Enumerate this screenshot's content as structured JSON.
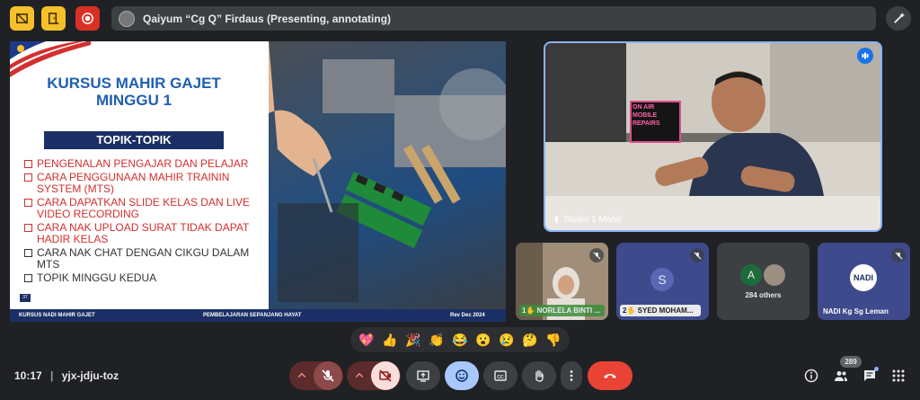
{
  "topbar": {
    "presenter_text": "Qaiyum “Cg Q” Firdaus (Presenting, annotating)"
  },
  "slide": {
    "title_line1": "KURSUS MAHIR GAJET",
    "title_line2": "MINGGU 1",
    "topik_header": "TOPIK-TOPIK",
    "items": [
      {
        "text": "PENGENALAN PENGAJAR DAN PELAJAR",
        "color": "#d32f2f"
      },
      {
        "text": "CARA PENGGUNAAN MAHIR TRAININ SYSTEM (MTS)",
        "color": "#d32f2f"
      },
      {
        "text": "CARA DAPATKAN SLIDE KELAS DAN LIVE VIDEO RECORDING",
        "color": "#d32f2f"
      },
      {
        "text": "CARA NAK UPLOAD SURAT TIDAK DAPAT HADIR KELAS",
        "color": "#d32f2f"
      },
      {
        "text": "CARA NAK CHAT DENGAN CIKGU DALAM MTS",
        "color": "#333333"
      },
      {
        "text": "TOPIK MINGGU KEDUA",
        "color": "#333333"
      }
    ],
    "page_number": "37",
    "footer_left": "KURSUS NADI MAHIR GAJET",
    "footer_center": "PEMBELAJARAN SEPANJANG HAYAT",
    "footer_right": "Rev Dec 2024"
  },
  "main_tile": {
    "name": "Studio 1 Mahir",
    "neon_text_1": "ON AIR",
    "neon_text_2": "MOBILE",
    "neon_text_3": "REPAIRS"
  },
  "tiles": [
    {
      "label": "NORLELA BINTI ...",
      "number": "1"
    },
    {
      "label": "SYED MOHAM...",
      "number": "2",
      "initial": "S"
    },
    {
      "label": "284 others",
      "initial": "A"
    },
    {
      "label": "NADI Kg Sg Leman",
      "logo": "NADI"
    }
  ],
  "reactions": [
    "💖",
    "👍",
    "🎉",
    "👏",
    "😂",
    "😮",
    "😢",
    "🤔",
    "👎"
  ],
  "bottombar": {
    "time": "10:17",
    "meeting_code": "yjx-jdju-toz",
    "participant_count": "289"
  },
  "colors": {
    "accent": "#8ab4f8",
    "record": "#d93025",
    "warning": "#f6c02b",
    "end_call": "#ea4335"
  }
}
